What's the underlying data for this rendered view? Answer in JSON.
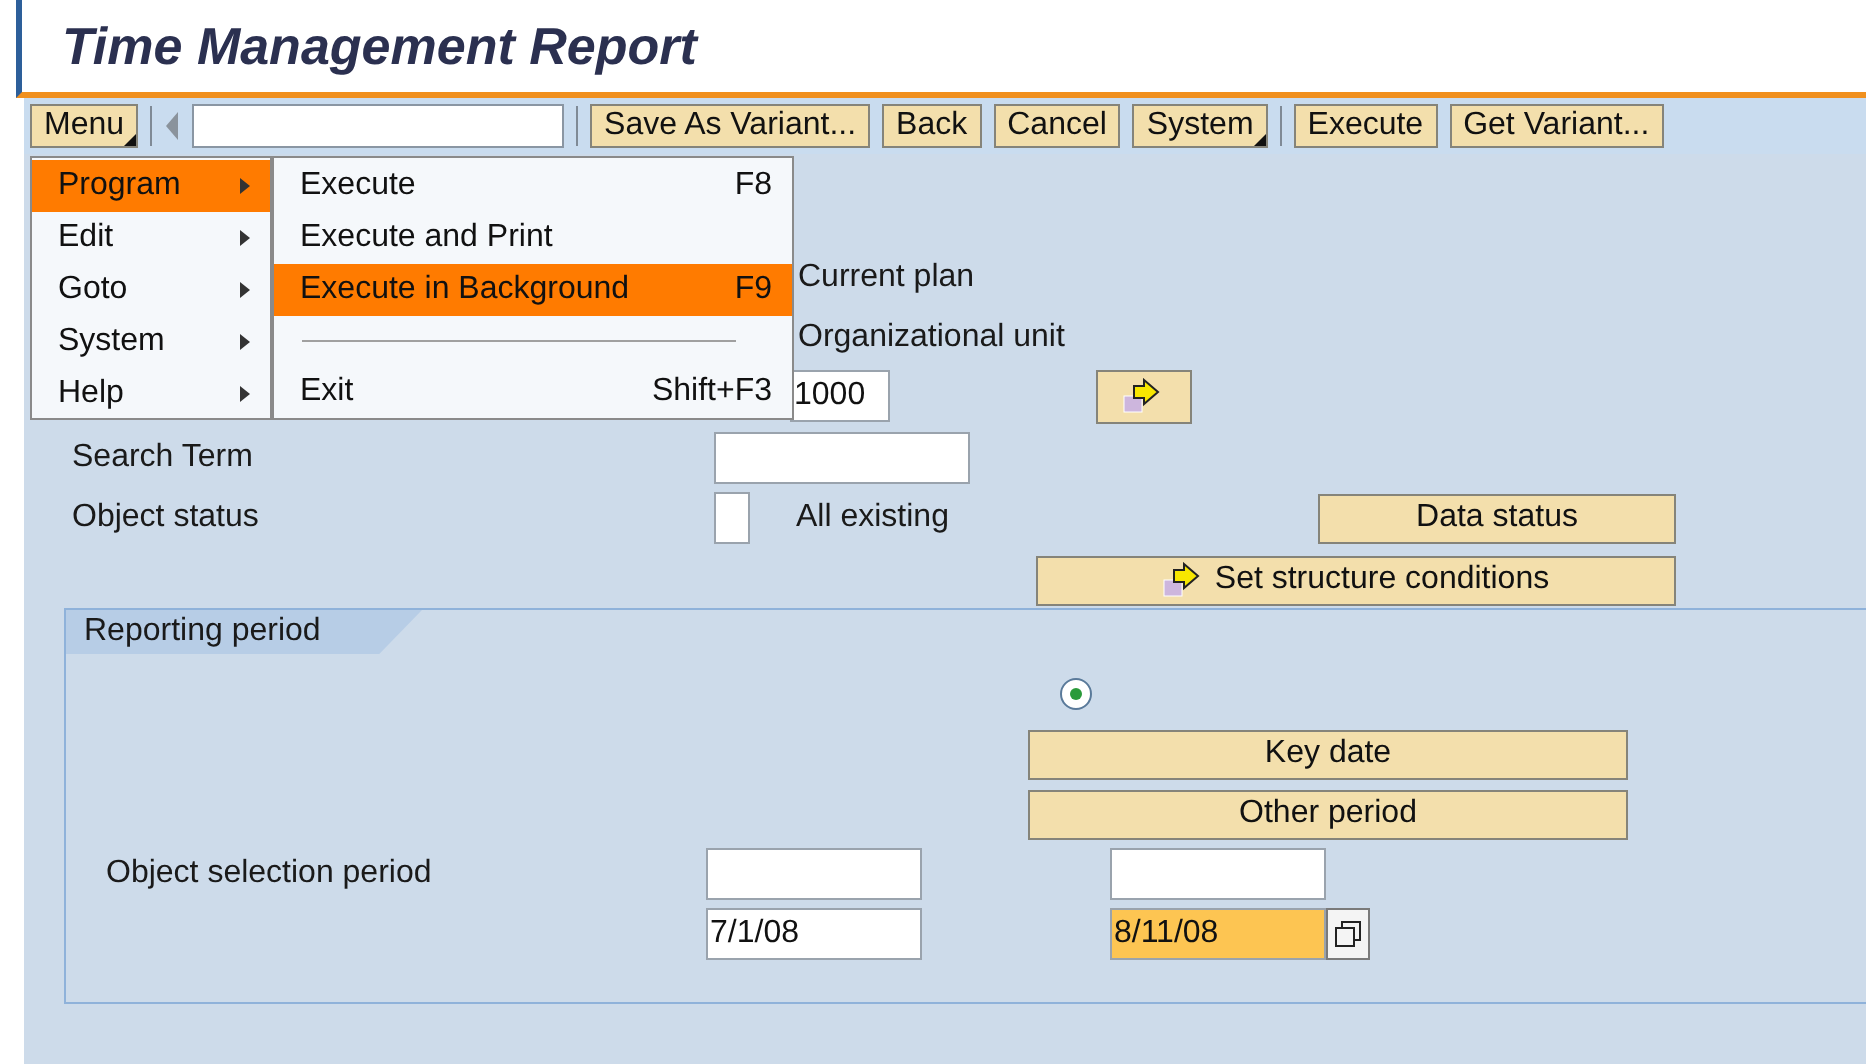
{
  "title": "Time Management Report",
  "toolbar": {
    "buttons": [
      {
        "label": "Menu",
        "has_dropdown": true,
        "separator_after": true
      },
      {
        "label": "Save As Variant...",
        "has_dropdown": false,
        "separator_after": false
      },
      {
        "label": "Back",
        "has_dropdown": false,
        "separator_after": false
      },
      {
        "label": "Cancel",
        "has_dropdown": false,
        "separator_after": false
      },
      {
        "label": "System",
        "has_dropdown": true,
        "separator_after": true
      },
      {
        "label": "Execute",
        "has_dropdown": false,
        "separator_after": false
      },
      {
        "label": "Get Variant...",
        "has_dropdown": false,
        "separator_after": false
      }
    ]
  },
  "menu": {
    "items": [
      {
        "label": "Program",
        "selected": true
      },
      {
        "label": "Edit",
        "selected": false
      },
      {
        "label": "Goto",
        "selected": false
      },
      {
        "label": "System",
        "selected": false
      },
      {
        "label": "Help",
        "selected": false
      }
    ],
    "submenu": [
      {
        "kind": "item",
        "label": "Execute",
        "shortcut": "F8",
        "selected": false
      },
      {
        "kind": "item",
        "label": "Execute and Print",
        "selected": false
      },
      {
        "kind": "item",
        "label": "Execute in Background",
        "shortcut": "F9",
        "selected": true
      },
      {
        "kind": "separator"
      },
      {
        "kind": "item",
        "label": "Exit",
        "shortcut": "Shift+F3",
        "selected": false
      }
    ]
  },
  "form": {
    "plan_label": "Current plan",
    "org_unit_label": "Organizational unit",
    "object_id": {
      "value": "1000"
    },
    "search_term": {
      "label": "Search Term"
    },
    "object_status": {
      "label": "Object status",
      "checked": false,
      "option_label": "All existing"
    },
    "data_status_button": "Data status",
    "structure_button": "Set structure conditions"
  },
  "reporting_period": {
    "title": "Reporting period",
    "radio_selected": true,
    "key_date_button": "Key date",
    "other_period_button": "Other period",
    "object_selection_label": "Object selection period",
    "from": "7/1/08",
    "to": "8/11/08",
    "to_highlighted": true
  }
}
